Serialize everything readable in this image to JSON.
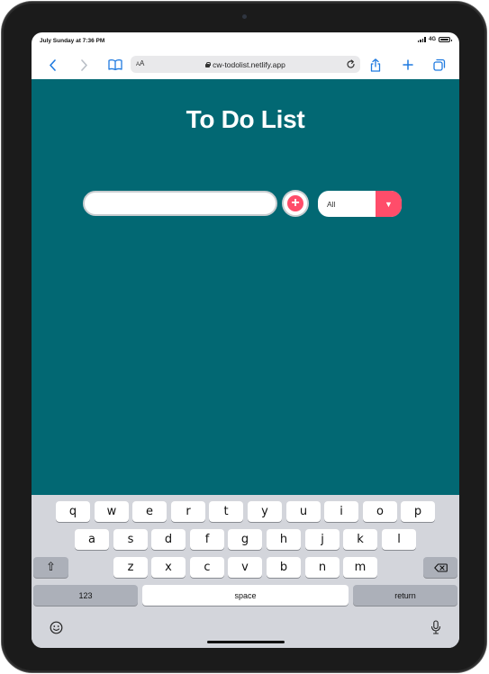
{
  "status_bar": {
    "time": "July Sunday at 7:36 PM",
    "network": "4G"
  },
  "browser": {
    "text_size_label": "AA",
    "url": "cw-todolist.netlify.app"
  },
  "page": {
    "title": "To Do List",
    "todo_input_value": "",
    "add_button_icon": "plus-circle-icon",
    "filter": {
      "selected": "All",
      "arrow": "▼"
    },
    "colors": {
      "background": "#026873",
      "accent": "#ff4d6a"
    }
  },
  "keyboard": {
    "row1": [
      "q",
      "w",
      "e",
      "r",
      "t",
      "y",
      "u",
      "i",
      "o",
      "p"
    ],
    "row2": [
      "a",
      "s",
      "d",
      "f",
      "g",
      "h",
      "j",
      "k",
      "l"
    ],
    "row3": [
      "z",
      "x",
      "c",
      "v",
      "b",
      "n",
      "m"
    ],
    "numbers_key": "123",
    "space_key": "space",
    "return_key": "return",
    "shift_glyph": "⇧"
  }
}
